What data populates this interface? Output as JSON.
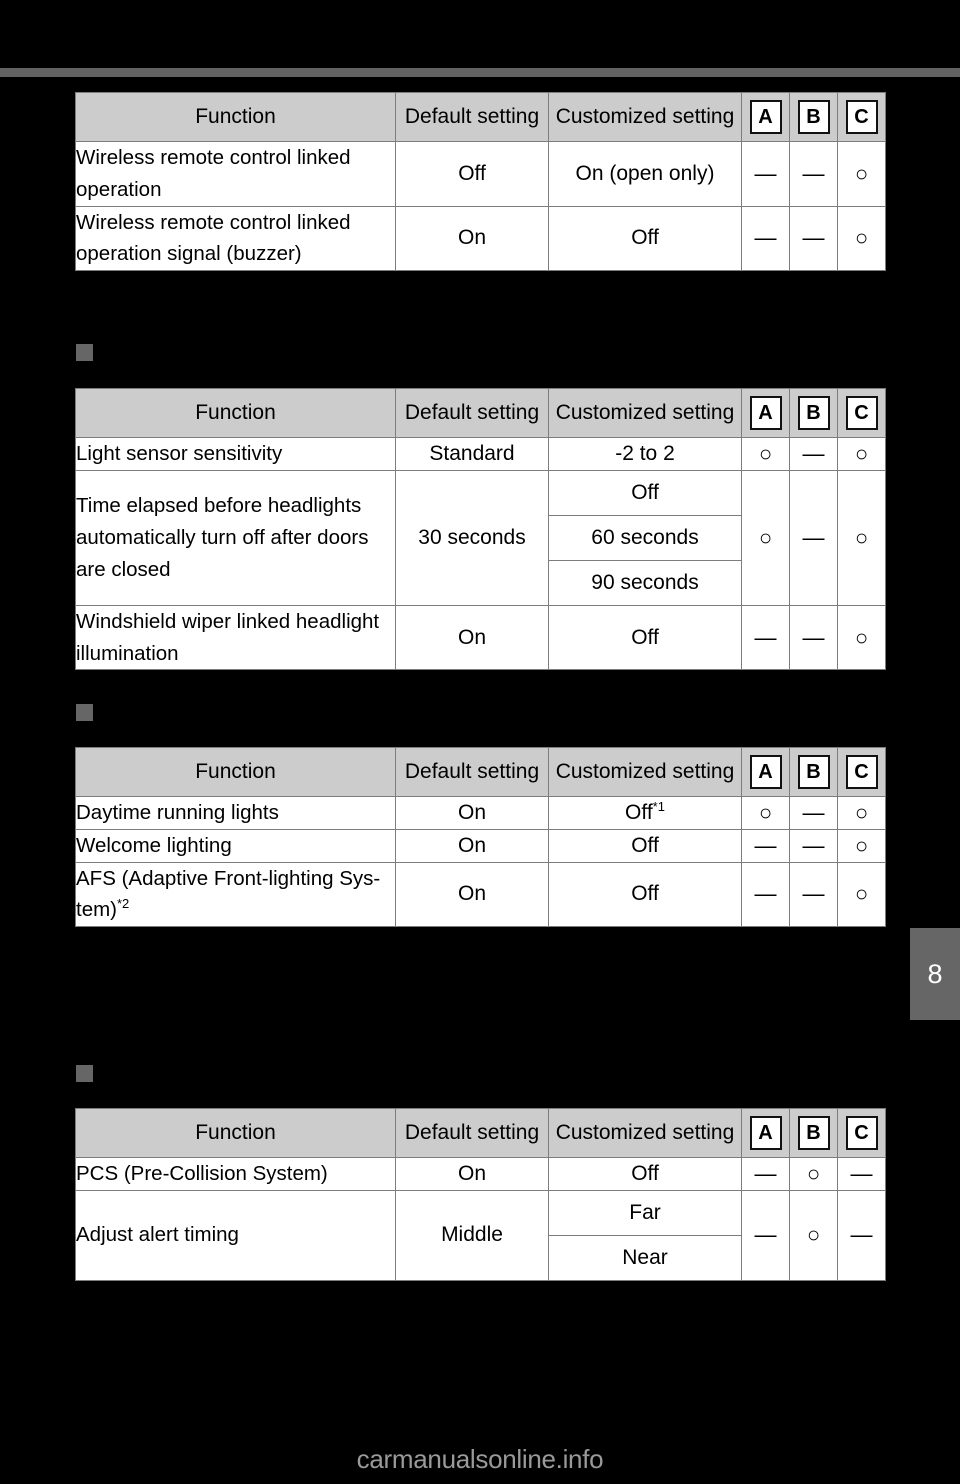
{
  "page": {
    "chapter_tab": "8",
    "footer": "carmanualsonline.info"
  },
  "columns": {
    "function": "Function",
    "default_setting": "Default setting",
    "customized_setting": "Customized setting",
    "a": "A",
    "b": "B",
    "c": "C"
  },
  "symbols": {
    "available": "○",
    "not_available": "—"
  },
  "tables": [
    {
      "id": "wireless-remote-control",
      "rows": [
        {
          "function": "Wireless remote control linked operation",
          "default": "Off",
          "customized": [
            "On (open only)"
          ],
          "a": "—",
          "b": "—",
          "c": "○"
        },
        {
          "function": "Wireless remote control linked operation signal (buzzer)",
          "default": "On",
          "customized": [
            "Off"
          ],
          "a": "—",
          "b": "—",
          "c": "○"
        }
      ]
    },
    {
      "id": "light-sensor-and-headlights",
      "rows": [
        {
          "function": "Light sensor sensitivity",
          "default": "Standard",
          "customized": [
            "-2 to 2"
          ],
          "a": "○",
          "b": "—",
          "c": "○"
        },
        {
          "function": "Time elapsed before headlights automatically turn off after doors are closed",
          "default": "30 seconds",
          "customized": [
            "Off",
            "60 seconds",
            "90 seconds"
          ],
          "a": "○",
          "b": "—",
          "c": "○"
        },
        {
          "function": "Windshield wiper linked headlight illumination",
          "default": "On",
          "customized": [
            "Off"
          ],
          "a": "—",
          "b": "—",
          "c": "○"
        }
      ]
    },
    {
      "id": "exterior-lighting",
      "rows": [
        {
          "function": "Daytime running lights",
          "default": "On",
          "customized": [
            "Off"
          ],
          "customized_sup": "*1",
          "a": "○",
          "b": "—",
          "c": "○"
        },
        {
          "function": "Welcome lighting",
          "default": "On",
          "customized": [
            "Off"
          ],
          "a": "—",
          "b": "—",
          "c": "○"
        },
        {
          "function": "AFS (Adaptive Front-lighting Sys-tem)",
          "function_sup": "*2",
          "default": "On",
          "customized": [
            "Off"
          ],
          "a": "—",
          "b": "—",
          "c": "○"
        }
      ]
    },
    {
      "id": "pre-collision-system",
      "rows": [
        {
          "function": "PCS (Pre-Collision System)",
          "default": "On",
          "customized": [
            "Off"
          ],
          "a": "—",
          "b": "○",
          "c": "—"
        },
        {
          "function": "Adjust alert timing",
          "default": "Middle",
          "customized": [
            "Far",
            "Near"
          ],
          "a": "—",
          "b": "○",
          "c": "—"
        }
      ]
    }
  ]
}
